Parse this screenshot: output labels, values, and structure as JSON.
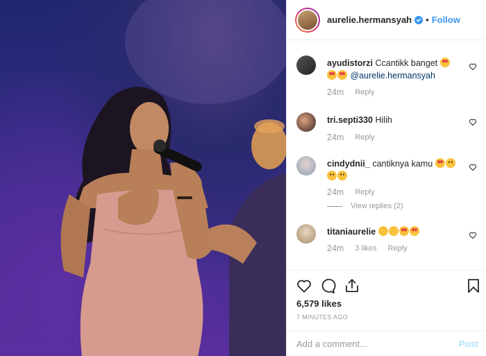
{
  "post": {
    "username": "aurelie.hermansyah",
    "follow_label": "Follow",
    "dot": "•"
  },
  "comments": [
    {
      "user": "ayudistorzi",
      "text": "Ccantikk banget",
      "mention": "@aurelie.hermansyah",
      "time": "24m",
      "reply_label": "Reply"
    },
    {
      "user": "tri.septi330",
      "text": "Hilih",
      "time": "24m",
      "reply_label": "Reply"
    },
    {
      "user": "cindydnii_",
      "text": "cantiknya kamu",
      "time": "24m",
      "reply_label": "Reply",
      "view_replies": "View replies (2)"
    },
    {
      "user": "titaniaurelie",
      "text": "",
      "time": "24m",
      "likes": "3 likes",
      "reply_label": "Reply"
    }
  ],
  "actions": {
    "likes_count": "6,579 likes",
    "timestamp": "7 MINUTES AGO"
  },
  "composer": {
    "placeholder": "Add a comment...",
    "post_label": "Post"
  },
  "icons": {
    "like": "heart-icon",
    "comment": "comment-icon",
    "share": "share-icon",
    "save": "bookmark-icon",
    "verified": "verified-badge-icon"
  },
  "colors": {
    "follow": "#3897f0",
    "verified": "#3897f0",
    "post_disabled": "#b2dffc",
    "muted": "#999999"
  }
}
